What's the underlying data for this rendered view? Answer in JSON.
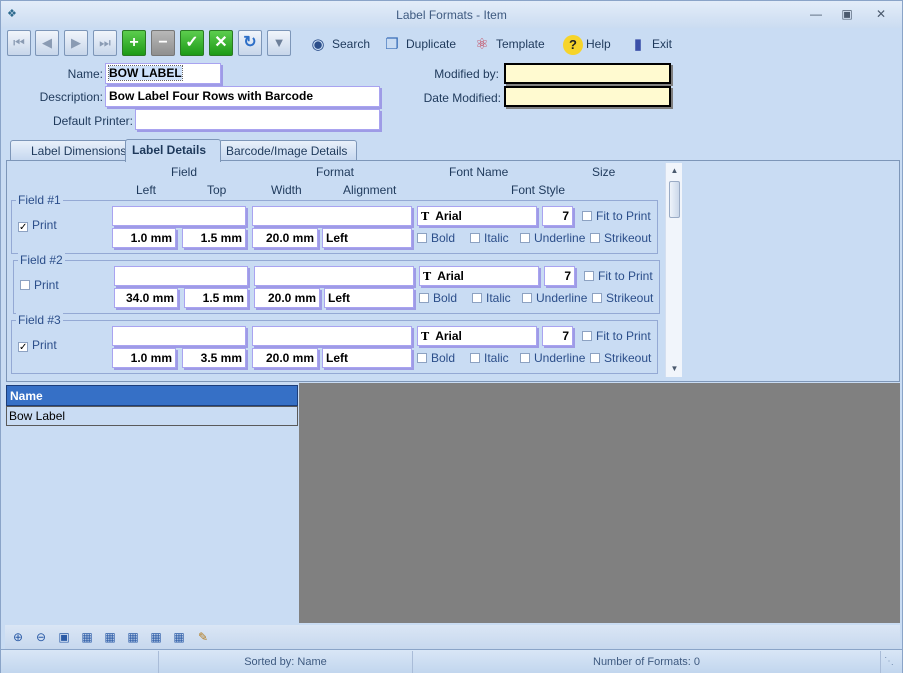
{
  "window": {
    "title": "Label Formats - Item"
  },
  "toolbar": {
    "search_label": "Search",
    "duplicate_label": "Duplicate",
    "template_label": "Template",
    "help_label": "Help",
    "exit_label": "Exit"
  },
  "form": {
    "name_label": "Name:",
    "name_value": "BOW LABEL",
    "description_label": "Description:",
    "description_value": "Bow Label Four Rows with Barcode",
    "default_printer_label": "Default Printer:",
    "default_printer_value": "",
    "modified_by_label": "Modified by:",
    "modified_by_value": "",
    "date_modified_label": "Date Modified:",
    "date_modified_value": ""
  },
  "tabs": [
    {
      "label": "Label Dimensions"
    },
    {
      "label": "Label Details"
    },
    {
      "label": "Barcode/Image Details"
    }
  ],
  "grid_headers": {
    "field": "Field",
    "format": "Format",
    "font_name": "Font Name",
    "size": "Size",
    "left": "Left",
    "top": "Top",
    "width": "Width",
    "alignment": "Alignment",
    "font_style": "Font Style"
  },
  "fields": [
    {
      "legend": "Field #1",
      "print_label": "Print",
      "print_checked": true,
      "field": "",
      "format": "",
      "left": "1.0 mm",
      "top": "1.5 mm",
      "width": "20.0 mm",
      "alignment": "Left",
      "font": "Arial",
      "size": "7",
      "fit": "Fit to Print",
      "bold": "Bold",
      "italic": "Italic",
      "underline": "Underline",
      "strikeout": "Strikeout"
    },
    {
      "legend": "Field #2",
      "print_label": "Print",
      "print_checked": false,
      "field": "",
      "format": "",
      "left": "34.0 mm",
      "top": "1.5 mm",
      "width": "20.0 mm",
      "alignment": "Left",
      "font": "Arial",
      "size": "7",
      "fit": "Fit to Print",
      "bold": "Bold",
      "italic": "Italic",
      "underline": "Underline",
      "strikeout": "Strikeout"
    },
    {
      "legend": "Field #3",
      "print_label": "Print",
      "print_checked": true,
      "field": "",
      "format": "",
      "left": "1.0 mm",
      "top": "3.5 mm",
      "width": "20.0 mm",
      "alignment": "Left",
      "font": "Arial",
      "size": "7",
      "fit": "Fit to Print",
      "bold": "Bold",
      "italic": "Italic",
      "underline": "Underline",
      "strikeout": "Strikeout"
    }
  ],
  "list": {
    "header": "Name",
    "rows": [
      "Bow Label"
    ]
  },
  "status": {
    "sorted_by": "Sorted by: Name",
    "count": "Number of Formats: 0"
  },
  "colors": {
    "accent": "#3670c6",
    "preview_bg": "#808080",
    "readonly_bg": "#fffad0"
  }
}
